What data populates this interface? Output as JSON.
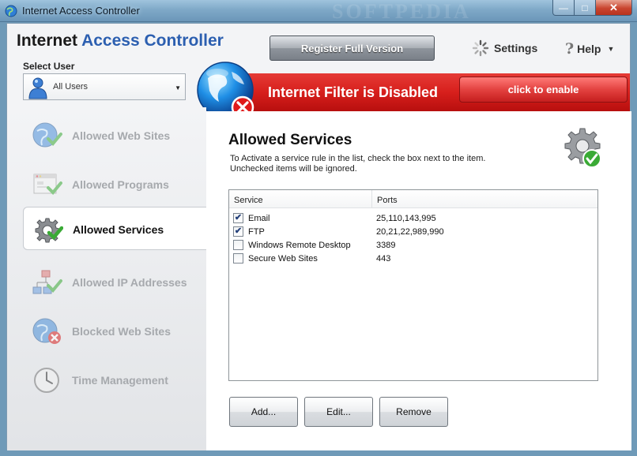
{
  "window": {
    "title": "Internet Access Controller",
    "watermark": "SOFTPEDIA"
  },
  "header": {
    "brand_part1": "Internet ",
    "brand_part2": "Access Controller",
    "register_label": "Register Full Version",
    "settings_label": "Settings",
    "help_label": "Help",
    "help_glyph": "?"
  },
  "user": {
    "label": "Select User",
    "selected": "All Users"
  },
  "filter": {
    "status": "Internet Filter is Disabled",
    "enable_label": "click to enable"
  },
  "nav": {
    "items": [
      {
        "label": "Allowed Web Sites",
        "icon": "globe-check-icon"
      },
      {
        "label": "Allowed Programs",
        "icon": "window-check-icon"
      },
      {
        "label": "Allowed Services",
        "icon": "gear-check-icon"
      },
      {
        "label": "Allowed IP Addresses",
        "icon": "network-check-icon"
      },
      {
        "label": "Blocked Web Sites",
        "icon": "globe-x-icon"
      },
      {
        "label": "Time Management",
        "icon": "clock-icon"
      }
    ],
    "active": "Allowed Services"
  },
  "main": {
    "title": "Allowed Services",
    "desc_line1": "To Activate a service rule in the list, check the box next to the item.",
    "desc_line2": "Unchecked items will be ignored.",
    "columns": {
      "service": "Service",
      "ports": "Ports"
    },
    "rows": [
      {
        "service": "Email",
        "ports": "25,110,143,995",
        "checked": true
      },
      {
        "service": "FTP",
        "ports": "20,21,22,989,990",
        "checked": true
      },
      {
        "service": "Windows Remote Desktop",
        "ports": "3389",
        "checked": false
      },
      {
        "service": "Secure Web Sites",
        "ports": "443",
        "checked": false
      }
    ],
    "buttons": {
      "add": "Add...",
      "edit": "Edit...",
      "remove": "Remove"
    }
  },
  "colors": {
    "accent": "#2c5fb0",
    "banner_red": "#d71f1c",
    "check_green": "#3aaa35"
  }
}
